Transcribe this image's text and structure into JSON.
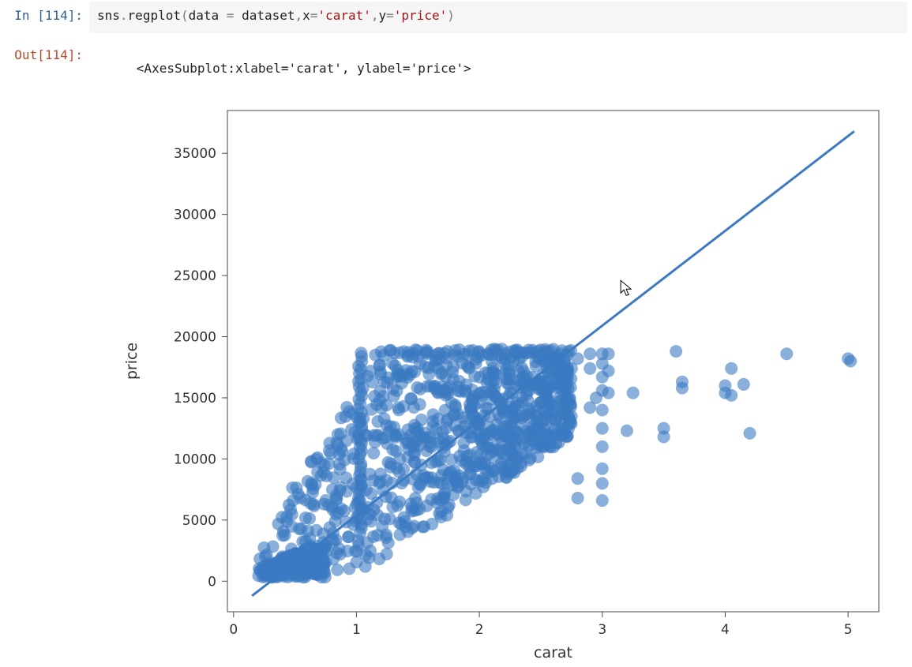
{
  "cell": {
    "in_prompt": "In [114]:",
    "out_prompt": "Out[114]:",
    "out_text": "<AxesSubplot:xlabel='carat', ylabel='price'>"
  },
  "code": {
    "t0": "sns",
    "t1": ".",
    "t2": "regplot",
    "t3": "(",
    "t4": "data",
    "t5": " = ",
    "t6": "dataset",
    "t7": ",",
    "t8": "x",
    "t9": "=",
    "t10": "'carat'",
    "t11": ",",
    "t12": "y",
    "t13": "=",
    "t14": "'price'",
    "t15": ")"
  },
  "chart_data": {
    "type": "scatter",
    "xlabel": "carat",
    "ylabel": "price",
    "xlim": [
      -0.05,
      5.25
    ],
    "ylim": [
      -2500,
      38500
    ],
    "xticks": [
      0,
      1,
      2,
      3,
      4,
      5
    ],
    "yticks": [
      0,
      5000,
      10000,
      15000,
      20000,
      25000,
      30000,
      35000
    ],
    "point_color": "#3b79c2",
    "point_radius": 8,
    "regression_line": {
      "x1": 0.15,
      "y1": -1200,
      "x2": 5.05,
      "y2": 36800
    },
    "cursor_at": {
      "x": 3.15,
      "y": 24600
    },
    "dense_region": {
      "x_min": 0.2,
      "x_max": 2.75,
      "description": "triangular wedge: for each carat c in [0.2,2.75], price spans roughly from max(300, 6500c-6000) up to min(19000, 15000c+500)",
      "n_points": 900
    },
    "sparse_points": [
      [
        0.75,
        6600
      ],
      [
        2.6,
        14300
      ],
      [
        2.62,
        13200
      ],
      [
        2.66,
        18600
      ],
      [
        2.7,
        16700
      ],
      [
        2.75,
        17400
      ],
      [
        2.8,
        18200
      ],
      [
        2.8,
        8400
      ],
      [
        2.8,
        6800
      ],
      [
        2.9,
        18600
      ],
      [
        2.9,
        17400
      ],
      [
        2.9,
        14200
      ],
      [
        2.95,
        15000
      ],
      [
        3.0,
        18600
      ],
      [
        3.0,
        17800
      ],
      [
        3.0,
        16700
      ],
      [
        3.0,
        15600
      ],
      [
        3.0,
        14000
      ],
      [
        3.0,
        12500
      ],
      [
        3.0,
        11000
      ],
      [
        3.0,
        9200
      ],
      [
        3.0,
        8000
      ],
      [
        3.0,
        6600
      ],
      [
        3.05,
        18600
      ],
      [
        3.05,
        17200
      ],
      [
        3.05,
        15400
      ],
      [
        3.2,
        12300
      ],
      [
        3.25,
        15400
      ],
      [
        3.5,
        11800
      ],
      [
        3.5,
        12500
      ],
      [
        3.6,
        18800
      ],
      [
        3.65,
        16300
      ],
      [
        3.65,
        15800
      ],
      [
        4.0,
        16000
      ],
      [
        4.0,
        15400
      ],
      [
        4.05,
        15200
      ],
      [
        4.05,
        17400
      ],
      [
        4.15,
        16100
      ],
      [
        4.2,
        12100
      ],
      [
        4.5,
        18600
      ],
      [
        5.0,
        18200
      ],
      [
        5.02,
        18000
      ]
    ]
  }
}
